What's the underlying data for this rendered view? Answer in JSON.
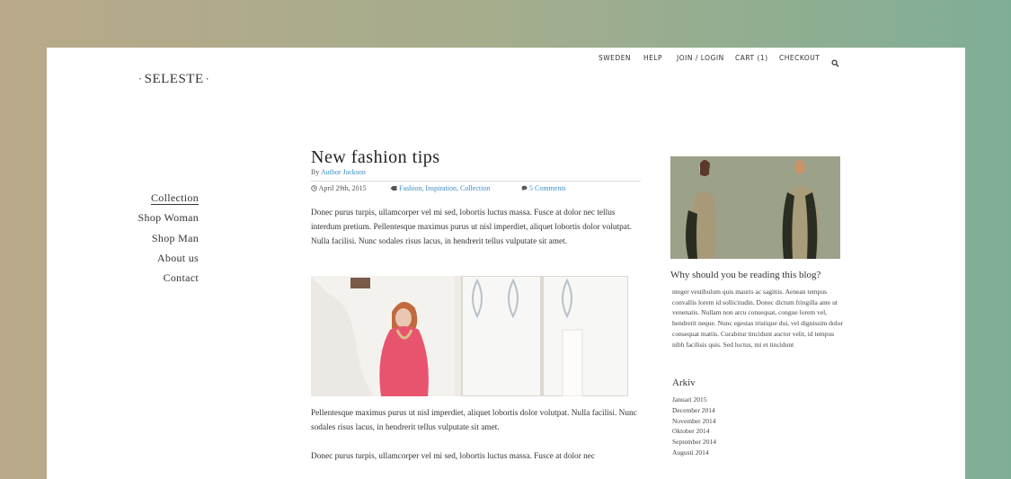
{
  "logo": "SELESTE",
  "topnav": {
    "items": [
      "SWEDEN",
      "HELP",
      "JOIN / LOGIN",
      "CART (1)",
      "CHECKOUT"
    ],
    "search_icon": "search-icon"
  },
  "sidenav": {
    "items": [
      "Collection",
      "Shop Woman",
      "Shop Man",
      "About us",
      "Contact"
    ]
  },
  "post": {
    "title": "New fashion tips",
    "by_label": "By",
    "author": "Author Jackson",
    "date": "April 29th, 2015",
    "date_icon": "clock-icon",
    "tags_icon": "tag-icon",
    "tags": "Fashion, Inspiration, Collection",
    "comments_icon": "comment-icon",
    "comments": "5 Comments",
    "paragraph1": "Donec purus turpis, ullamcorper vel mi sed, lobortis luctus massa. Fusce at dolor nec tellus interdum pretium. Pellentesque maximus purus ut nisl imperdiet, aliquet lobortis dolor volutpat. Nulla facilisi. Nunc sodales risus lacus, in hendrerit tellus vulputate sit amet.",
    "paragraph2": "Pellentesque maximus purus ut nisl imperdiet, aliquet lobortis dolor volutpat. Nulla facilisi. Nunc sodales risus lacus, in hendrerit tellus vulputate sit amet.",
    "paragraph3": "Donec purus turpis, ullamcorper vel mi sed, lobortis luctus massa. Fusce at dolor nec"
  },
  "sidebar": {
    "heading": "Why should you be reading this blog?",
    "text": "nteger vestibulum quis mauris ac sagittis. Aenean tempus convallis lorem id sollicitudin. Donec dictum fringilla ante ut venenatis. Nullam non arcu consequat, congue lorem vel, hendrerit neque. Nunc egestas tristique dui, vel dignissim dolor consequat mattis. Curabitur tincidunt auctor velit, id tempus nibh facilisis quis. Sed luctus, mi et tincidunt",
    "arkiv_heading": "Arkiv",
    "arkiv": [
      "Januari 2015",
      "December 2014",
      "November 2014",
      "Oktober 2014",
      "September 2014",
      "Augusti 2014"
    ]
  },
  "colors": {
    "link": "#3b8fc4",
    "dress": "#e8546e"
  }
}
